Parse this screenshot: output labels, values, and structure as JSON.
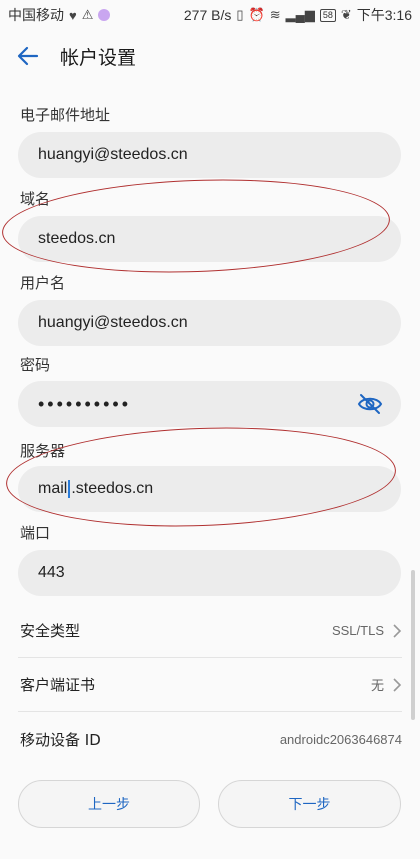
{
  "status_bar": {
    "carrier": "中国移动",
    "network_speed": "277 B/s",
    "battery": "58",
    "time": "下午3:16"
  },
  "header": {
    "title": "帐户设置"
  },
  "fields": {
    "email": {
      "label": "电子邮件地址",
      "value": "huangyi@steedos.cn"
    },
    "domain": {
      "label": "域名",
      "value": "steedos.cn"
    },
    "username": {
      "label": "用户名",
      "value": "huangyi@steedos.cn"
    },
    "password": {
      "label": "密码",
      "value": "••••••••••"
    },
    "server": {
      "label": "服务器",
      "value_before_cursor": "mail",
      "value_after_cursor": ".steedos.cn"
    },
    "port": {
      "label": "端口",
      "value": "443"
    }
  },
  "settings_rows": {
    "security_type": {
      "label": "安全类型",
      "value": "SSL/TLS"
    },
    "client_cert": {
      "label": "客户端证书",
      "value": "无"
    },
    "device_id": {
      "label": "移动设备 ID",
      "value": "androidc2063646874"
    }
  },
  "buttons": {
    "prev": "上一步",
    "next": "下一步"
  },
  "colors": {
    "accent": "#1e66c2",
    "annotation": "#b03030"
  }
}
